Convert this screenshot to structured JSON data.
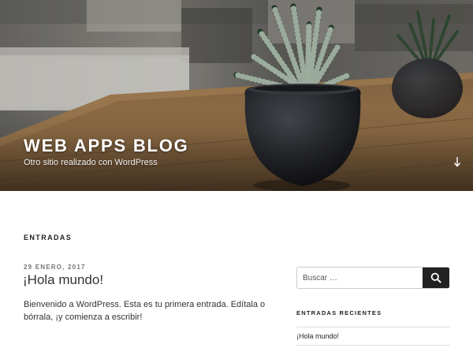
{
  "header": {
    "site_title": "WEB APPS BLOG",
    "site_description": "Otro sitio realizado con WordPress",
    "scroll_icon": "arrow-down-icon"
  },
  "main": {
    "section_title": "ENTRADAS",
    "post": {
      "date": "29 ENERO, 2017",
      "title": "¡Hola mundo!",
      "excerpt": "Bienvenido a WordPress. Esta es tu primera entrada. Edítala o bórrala, ¡y comienza a escribir!"
    }
  },
  "sidebar": {
    "search": {
      "placeholder": "Buscar …",
      "icon": "search-icon"
    },
    "recent_posts": {
      "title": "ENTRADAS RECIENTES",
      "items": [
        "¡Hola mundo!"
      ]
    }
  },
  "colors": {
    "text": "#222222",
    "meta": "#767676",
    "button": "#222222",
    "border": "#dddddd"
  }
}
